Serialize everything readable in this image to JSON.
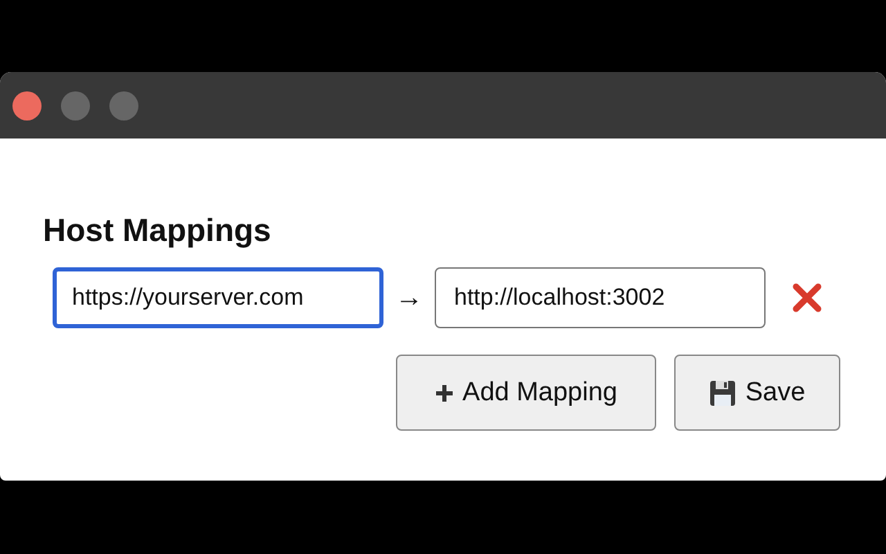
{
  "window": {
    "controls": [
      {
        "kind": "close"
      },
      {
        "kind": "minimize"
      },
      {
        "kind": "zoom"
      }
    ]
  },
  "heading": "Host Mappings",
  "mappings": [
    {
      "source": "https://yourserver.com",
      "source_focused": true,
      "arrow": "→",
      "target": "http://localhost:3002",
      "target_focused": false
    }
  ],
  "buttons": [
    {
      "kind": "add",
      "label": "Add Mapping"
    },
    {
      "kind": "save",
      "label": "Save"
    }
  ]
}
